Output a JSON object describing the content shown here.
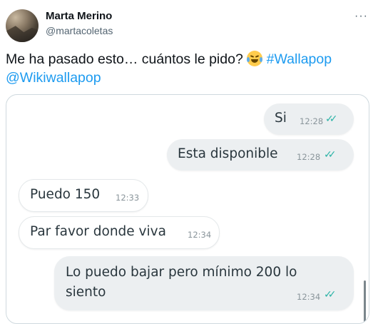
{
  "tweet": {
    "author_name": "Marta Merino",
    "author_handle": "@martacoletas",
    "text_before": "Me ha pasado esto… cuántos le pido?",
    "hashtag": "#Wallapop",
    "mention": "@Wikiwallapop"
  },
  "chat": {
    "messages": [
      {
        "direction": "out",
        "text": "Si",
        "time": "12:28",
        "read": true
      },
      {
        "direction": "out",
        "text": "Esta disponible",
        "time": "12:28",
        "read": true
      },
      {
        "direction": "in",
        "text": "Puedo 150",
        "time": "12:33"
      },
      {
        "direction": "in",
        "text": "Par favor donde viva",
        "time": "12:34"
      },
      {
        "direction": "out",
        "text_line1": "Lo puedo bajar pero mínimo 200 lo",
        "text_line2": "siento",
        "time": "12:34",
        "read": true
      }
    ],
    "read_color": "#2ab3a6"
  }
}
